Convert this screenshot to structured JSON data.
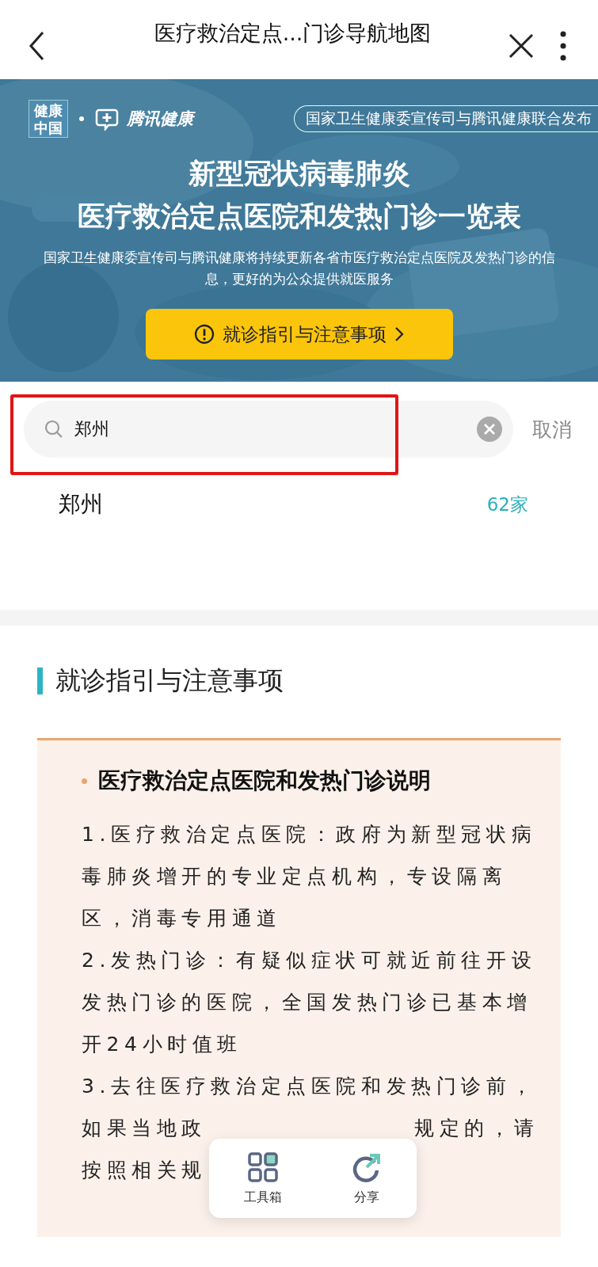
{
  "nav_bar": {
    "title": "医疗救治定点...门诊导航地图"
  },
  "banner": {
    "logo_left": "健康中国",
    "logo_right": "腾讯健康",
    "publisher": "国家卫生健康委宣传司与腾讯健康联合发布",
    "title_lines": [
      "新型冠状病毒肺炎",
      "医疗救治定点医院和发热门诊一览表"
    ],
    "subtitle": "国家卫生健康委宣传司与腾讯健康将持续更新各省市医疗救治定点医院及发热门诊的信息，更好的为公众提供就医服务",
    "guide_button": "就诊指引与注意事项"
  },
  "search": {
    "value": "郑州",
    "cancel": "取消",
    "highlighted": true
  },
  "results": [
    {
      "city": "郑州",
      "count": "62家"
    }
  ],
  "guide": {
    "heading": "就诊指引与注意事项",
    "card_title": "医疗救治定点医院和发热门诊说明",
    "items": [
      {
        "kind": "text",
        "text": "1.医疗救治定点医院：政府为新型冠状病毒肺炎增开的专业定点机构，专设隔离区，消毒专用通道"
      },
      {
        "kind": "text",
        "text": "2.发热门诊：有疑似症状可就近前往开设发热门诊的医院，全国发热门诊已基本增开24小时值班"
      },
      {
        "kind": "lines",
        "lines": [
          [
            "3.去往医疗救治定点医院和发热门诊前，"
          ],
          [
            "如果当地政",
            "规定的，请"
          ],
          [
            "按照相关规"
          ]
        ]
      }
    ]
  },
  "toolbar": [
    {
      "kind": "tools",
      "label": "工具箱"
    },
    {
      "kind": "share",
      "label": "分享"
    }
  ]
}
